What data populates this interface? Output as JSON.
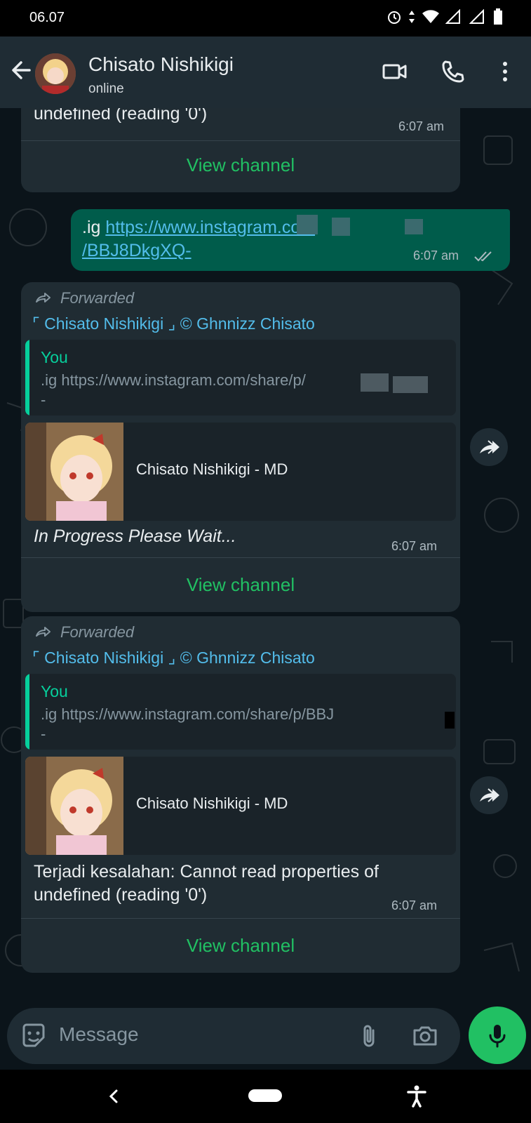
{
  "status_bar": {
    "time": "06.07"
  },
  "header": {
    "contact_name": "Chisato Nishikigi",
    "contact_status": "online"
  },
  "messages": {
    "m1": {
      "text": "undefined (reading '0')",
      "time": "6:07 am",
      "action": "View channel"
    },
    "m2": {
      "text_prefix": ".ig ",
      "link_line1": "https://www.instagram.com",
      "link_line2": "/BBJ8DkgXQ-",
      "time": "6:07 am"
    },
    "m3": {
      "forwarded": "Forwarded",
      "channel": "⌜ Chisato Nishikigi ⌟ © Ghnnizz Chisato",
      "quote_author": "You",
      "quote_text": ".ig https://www.instagram.com/share/p/",
      "quote_text2": "-",
      "preview_title": "Chisato Nishikigi - MD",
      "text": "In Progress Please Wait...",
      "time": "6:07 am",
      "action": "View channel"
    },
    "m4": {
      "forwarded": "Forwarded",
      "channel": "⌜ Chisato Nishikigi ⌟ © Ghnnizz Chisato",
      "quote_author": "You",
      "quote_text": ".ig https://www.instagram.com/share/p/BBJ",
      "quote_text2": "-",
      "preview_title": "Chisato Nishikigi - MD",
      "text_line1": "Terjadi kesalahan: Cannot read properties of",
      "text_line2": "undefined (reading '0')",
      "time": "6:07 am",
      "action": "View channel"
    }
  },
  "composer": {
    "placeholder": "Message"
  },
  "colors": {
    "accent": "#21c063",
    "outgoing_bubble": "#005c4b",
    "incoming_bubble": "#202c33",
    "link": "#53bdeb"
  }
}
